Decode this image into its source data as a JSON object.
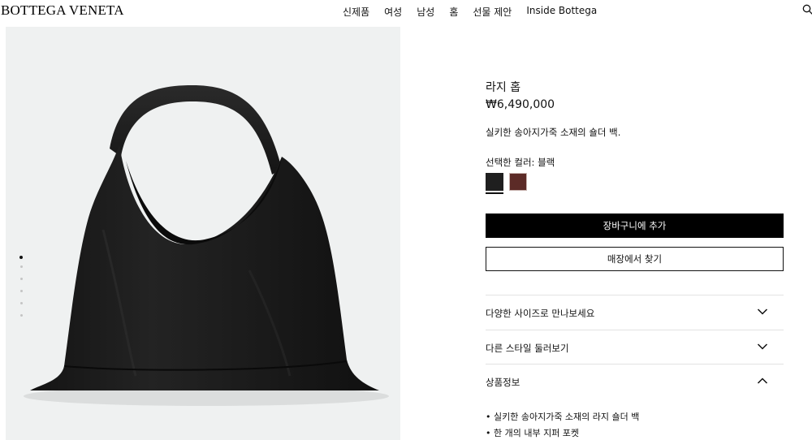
{
  "header": {
    "logo": "BOTTEGA VENETA",
    "nav": [
      "신제품",
      "여성",
      "남성",
      "홈",
      "선물 제안",
      "Inside Bottega"
    ]
  },
  "gallery": {
    "dots_total": 6,
    "active_index": 0
  },
  "product": {
    "title": "라지 홉",
    "price": "₩6,490,000",
    "description": "실키한 송아지가죽 소재의 숄더 백.",
    "color_label": "선택한 컬러: 블랙",
    "swatches": [
      {
        "name": "블랙",
        "color": "#1f1f1f",
        "selected": true
      },
      {
        "name": "브라운",
        "color": "#5c2b27",
        "selected": false
      }
    ],
    "add_to_cart": "장바구니에 추가",
    "find_in_store": "매장에서 찾기"
  },
  "accordions": [
    {
      "label": "다양한 사이즈로 만나보세요",
      "expanded": false
    },
    {
      "label": "다른 스타일 둘러보기",
      "expanded": false
    },
    {
      "label": "상품정보",
      "expanded": true
    }
  ],
  "details": [
    "• 실키한 송아지가죽 소재의 라지 숄더 백",
    "• 한 개의 내부 지퍼 포켓"
  ],
  "icons": {
    "search": "search-icon",
    "chevron_down": "chevron-down-icon",
    "chevron_up": "chevron-up-icon"
  }
}
